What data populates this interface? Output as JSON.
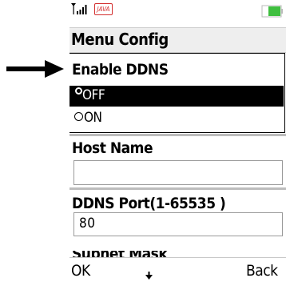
{
  "statusbar": {
    "java_badge": "JAVA",
    "icons": [
      "signal-strength-icon",
      "java-icon",
      "battery-icon"
    ]
  },
  "header": {
    "title": "Menu Config"
  },
  "form": {
    "enable_ddns": {
      "label": "Enable DDNS",
      "options": [
        {
          "label": "OFF",
          "selected": true
        },
        {
          "label": "ON",
          "selected": false
        }
      ]
    },
    "host_name": {
      "label": "Host Name",
      "value": ""
    },
    "ddns_port": {
      "label": "DDNS Port(1-65535 )",
      "value": "80"
    },
    "next_field": {
      "label": "Subnet Mask"
    }
  },
  "softkeys": {
    "left": "OK",
    "right": "Back",
    "center_icon": "down-arrow-icon"
  },
  "colors": {
    "selection": "#000000",
    "java_badge": "#d32f2f",
    "battery": "#3fbf3f",
    "divider": "#bdbdbd"
  }
}
